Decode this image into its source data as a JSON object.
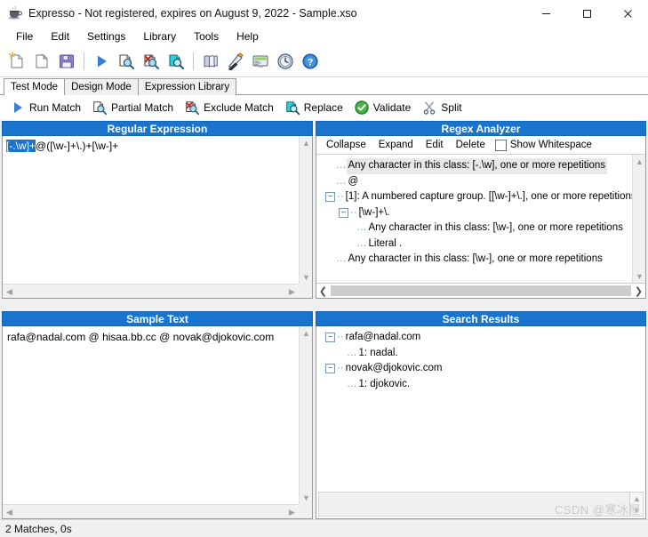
{
  "window": {
    "title": "Expresso - Not registered, expires on August 9, 2022 - Sample.xso",
    "app_icon": "expresso-cup-icon",
    "minimize_label": "–",
    "maximize_label": "□",
    "close_label": "✕"
  },
  "menu": {
    "items": [
      {
        "label": "File"
      },
      {
        "label": "Edit"
      },
      {
        "label": "Settings"
      },
      {
        "label": "Library"
      },
      {
        "label": "Tools"
      },
      {
        "label": "Help"
      }
    ]
  },
  "toolbar": {
    "buttons": [
      {
        "name": "new-icon",
        "title": "New"
      },
      {
        "name": "open-icon",
        "title": "Open"
      },
      {
        "name": "save-icon",
        "title": "Save"
      },
      {
        "name": "run-match-icon",
        "title": "Run Match"
      },
      {
        "name": "partial-match-icon",
        "title": "Partial Match"
      },
      {
        "name": "exclude-match-icon",
        "title": "Exclude Match"
      },
      {
        "name": "replace-icon",
        "title": "Replace"
      },
      {
        "name": "library-icon",
        "title": "Library"
      },
      {
        "name": "design-icon",
        "title": "Design"
      },
      {
        "name": "expression-icon",
        "title": "Expression"
      },
      {
        "name": "history-clock-icon",
        "title": "History"
      },
      {
        "name": "help-icon",
        "title": "Help"
      }
    ]
  },
  "tabs": [
    {
      "label": "Test Mode",
      "active": true
    },
    {
      "label": "Design Mode",
      "active": false
    },
    {
      "label": "Expression Library",
      "active": false
    }
  ],
  "actions": [
    {
      "label": "Run Match",
      "icon": "run-triangle-icon"
    },
    {
      "label": "Partial Match",
      "icon": "partial-match-icon"
    },
    {
      "label": "Exclude Match",
      "icon": "exclude-match-icon"
    },
    {
      "label": "Replace",
      "icon": "replace-icon"
    },
    {
      "label": "Validate",
      "icon": "validate-check-icon"
    },
    {
      "label": "Split",
      "icon": "split-scissors-icon"
    }
  ],
  "regex_panel": {
    "title": "Regular Expression",
    "selected_fragment": "[-.\\w]+",
    "rest": "@([\\w-]+\\.)+[\\w-]+"
  },
  "analyzer_panel": {
    "title": "Regex Analyzer",
    "tools": [
      {
        "label": "Collapse"
      },
      {
        "label": "Expand"
      },
      {
        "label": "Edit"
      },
      {
        "label": "Delete"
      }
    ],
    "show_whitespace_label": "Show Whitespace",
    "show_whitespace_checked": false,
    "tree": [
      {
        "label": "Any character in this class: [-.\\w], one or more repetitions",
        "indent": 1,
        "toggle": "none",
        "selected": true
      },
      {
        "label": "@",
        "indent": 1,
        "toggle": "none",
        "selected": false
      },
      {
        "label": "[1]: A numbered capture group. [[\\w-]+\\.], one or more repetitions",
        "indent": 0,
        "toggle": "minus",
        "selected": false
      },
      {
        "label": "[\\w-]+\\.",
        "indent": 1,
        "toggle": "minus",
        "selected": false
      },
      {
        "label": "Any character in this class: [\\w-], one or more repetitions",
        "indent": 2,
        "toggle": "none",
        "selected": false
      },
      {
        "label": "Literal .",
        "indent": 2,
        "toggle": "none",
        "selected": false
      },
      {
        "label": "Any character in this class: [\\w-], one or more repetitions",
        "indent": 1,
        "toggle": "none",
        "selected": false
      }
    ]
  },
  "sample_panel": {
    "title": "Sample Text",
    "text": "rafa@nadal.com @ hisaa.bb.cc @ novak@djokovic.com"
  },
  "results_panel": {
    "title": "Search Results",
    "tree": [
      {
        "label": "rafa@nadal.com",
        "indent": 0,
        "toggle": "minus"
      },
      {
        "label": "1: nadal.",
        "indent": 1,
        "toggle": "none"
      },
      {
        "label": "novak@djokovic.com",
        "indent": 0,
        "toggle": "minus"
      },
      {
        "label": "1: djokovic.",
        "indent": 1,
        "toggle": "none"
      }
    ]
  },
  "statusbar": {
    "text": "2 Matches, 0s"
  },
  "watermark": {
    "text": "CSDN @寒冰屋"
  },
  "colors": {
    "panel_header": "#1874cd",
    "selection": "#1874cd",
    "window_bg": "#f0f0f0"
  }
}
